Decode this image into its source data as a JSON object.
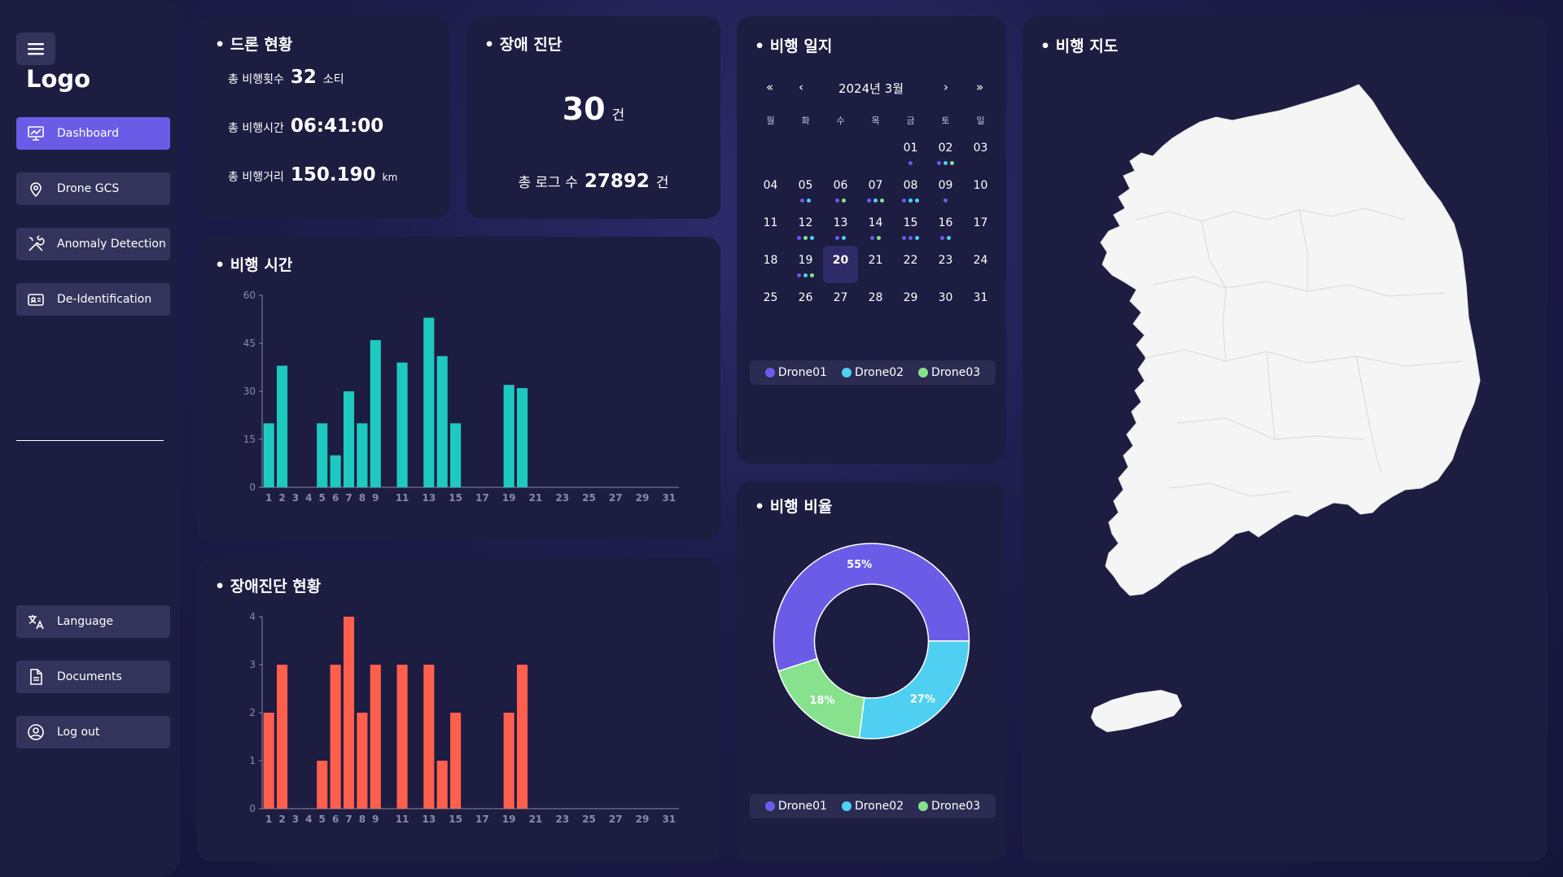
{
  "sidebar": {
    "logo": "Logo",
    "nav": [
      {
        "label": "Dashboard",
        "icon": "presentation-chart-icon"
      },
      {
        "label": "Drone GCS",
        "icon": "map-pin-icon"
      },
      {
        "label": "Anomaly Detection",
        "icon": "tools-icon"
      },
      {
        "label": "De-Identification",
        "icon": "id-card-icon"
      }
    ],
    "bottom": [
      {
        "label": "Language",
        "icon": "translate-icon"
      },
      {
        "label": "Documents",
        "icon": "document-icon"
      },
      {
        "label": "Log out",
        "icon": "user-circle-icon"
      }
    ]
  },
  "drone_status": {
    "title": "• 드론 현황",
    "flights_label": "총 비행횟수",
    "flights_value": "32",
    "flights_unit": "소티",
    "time_label": "총 비행시간",
    "time_value": "06:41:00",
    "distance_label": "총 비행거리",
    "distance_value": "150.190",
    "distance_unit": "km"
  },
  "fault_diag": {
    "title": "• 장애 진단",
    "count": "30",
    "count_unit": "건",
    "logs_label": "총 로그 수",
    "logs_value": "27892",
    "logs_unit": "건"
  },
  "flight_log": {
    "title": "• 비행 일지",
    "month": "2024년 3월",
    "nav": {
      "first": "«",
      "prev": "‹",
      "next": "›",
      "last": "»"
    },
    "weekdays": [
      "월",
      "화",
      "수",
      "목",
      "금",
      "토",
      "일"
    ],
    "weeks": [
      [
        "",
        "",
        "",
        "",
        "01",
        "02",
        "03"
      ],
      [
        "04",
        "05",
        "06",
        "07",
        "08",
        "09",
        "10"
      ],
      [
        "11",
        "12",
        "13",
        "14",
        "15",
        "16",
        "17"
      ],
      [
        "18",
        "19",
        "20",
        "21",
        "22",
        "23",
        "24"
      ],
      [
        "25",
        "26",
        "27",
        "28",
        "29",
        "30",
        "31"
      ]
    ],
    "today": "20",
    "flight_days": {
      "01": [
        "drone01"
      ],
      "02": [
        "drone01",
        "drone02",
        "drone03"
      ],
      "05": [
        "drone01",
        "drone02"
      ],
      "06": [
        "drone01",
        "drone03"
      ],
      "07": [
        "drone01",
        "drone02",
        "drone03"
      ],
      "08": [
        "drone01",
        "drone02",
        "drone02"
      ],
      "09": [
        "drone01"
      ],
      "12": [
        "drone01",
        "drone03",
        "drone02"
      ],
      "13": [
        "drone01",
        "drone02"
      ],
      "14": [
        "drone01",
        "drone03"
      ],
      "15": [
        "drone01",
        "drone01",
        "drone02"
      ],
      "16": [
        "drone01",
        "drone02"
      ],
      "19": [
        "drone01",
        "drone02",
        "drone03"
      ]
    },
    "legend": [
      "Drone01",
      "Drone02",
      "Drone03"
    ]
  },
  "flight_map": {
    "title": "• 비행 지도"
  },
  "flight_ratio": {
    "title": "• 비행 비율",
    "legend": [
      "Drone01",
      "Drone02",
      "Drone03"
    ]
  },
  "colors": {
    "drone01": "#6b5ce7",
    "drone02": "#4fd0f2",
    "drone03": "#86e28d",
    "flight_bar": "#1ecac0",
    "fault_bar": "#ff5f4d",
    "accent": "#6b5ce7"
  },
  "chart_data": [
    {
      "type": "bar",
      "title": "• 비행 시간",
      "x": [
        1,
        2,
        3,
        4,
        5,
        6,
        7,
        8,
        9,
        10,
        11,
        12,
        13,
        14,
        15,
        16,
        17,
        18,
        19,
        20,
        21,
        22,
        23,
        24,
        25,
        26,
        27,
        28,
        29,
        30,
        31
      ],
      "x_tick_labels": [
        "1",
        "2",
        "3",
        "4",
        "5",
        "6",
        "7",
        "8",
        "9",
        "11",
        "13",
        "15",
        "17",
        "19",
        "21",
        "23",
        "25",
        "27",
        "29",
        "31"
      ],
      "values": [
        20,
        38,
        0,
        0,
        20,
        10,
        30,
        20,
        46,
        0,
        39,
        0,
        53,
        41,
        20,
        0,
        0,
        0,
        32,
        31,
        0,
        0,
        0,
        0,
        0,
        0,
        0,
        0,
        0,
        0,
        0
      ],
      "ylim": [
        0,
        60
      ],
      "yticks": [
        0,
        15,
        30,
        45,
        60
      ],
      "grid": false
    },
    {
      "type": "bar",
      "title": "• 장애진단 현황",
      "x": [
        1,
        2,
        3,
        4,
        5,
        6,
        7,
        8,
        9,
        10,
        11,
        12,
        13,
        14,
        15,
        16,
        17,
        18,
        19,
        20,
        21,
        22,
        23,
        24,
        25,
        26,
        27,
        28,
        29,
        30,
        31
      ],
      "x_tick_labels": [
        "1",
        "2",
        "3",
        "4",
        "5",
        "6",
        "7",
        "8",
        "9",
        "11",
        "13",
        "15",
        "17",
        "19",
        "21",
        "23",
        "25",
        "27",
        "29",
        "31"
      ],
      "values": [
        2,
        3,
        0,
        0,
        1,
        3,
        4,
        2,
        3,
        0,
        3,
        0,
        3,
        1,
        2,
        0,
        0,
        0,
        2,
        3,
        0,
        0,
        0,
        0,
        0,
        0,
        0,
        0,
        0,
        0,
        0
      ],
      "ylim": [
        0,
        4
      ],
      "yticks": [
        0,
        1,
        2,
        3,
        4
      ],
      "grid": false
    },
    {
      "type": "pie",
      "title": "",
      "categories": [
        "Drone01",
        "Drone02",
        "Drone03"
      ],
      "values": [
        55,
        27,
        18
      ],
      "labels": [
        "55%",
        "27%",
        "18%"
      ],
      "donut": true
    }
  ]
}
